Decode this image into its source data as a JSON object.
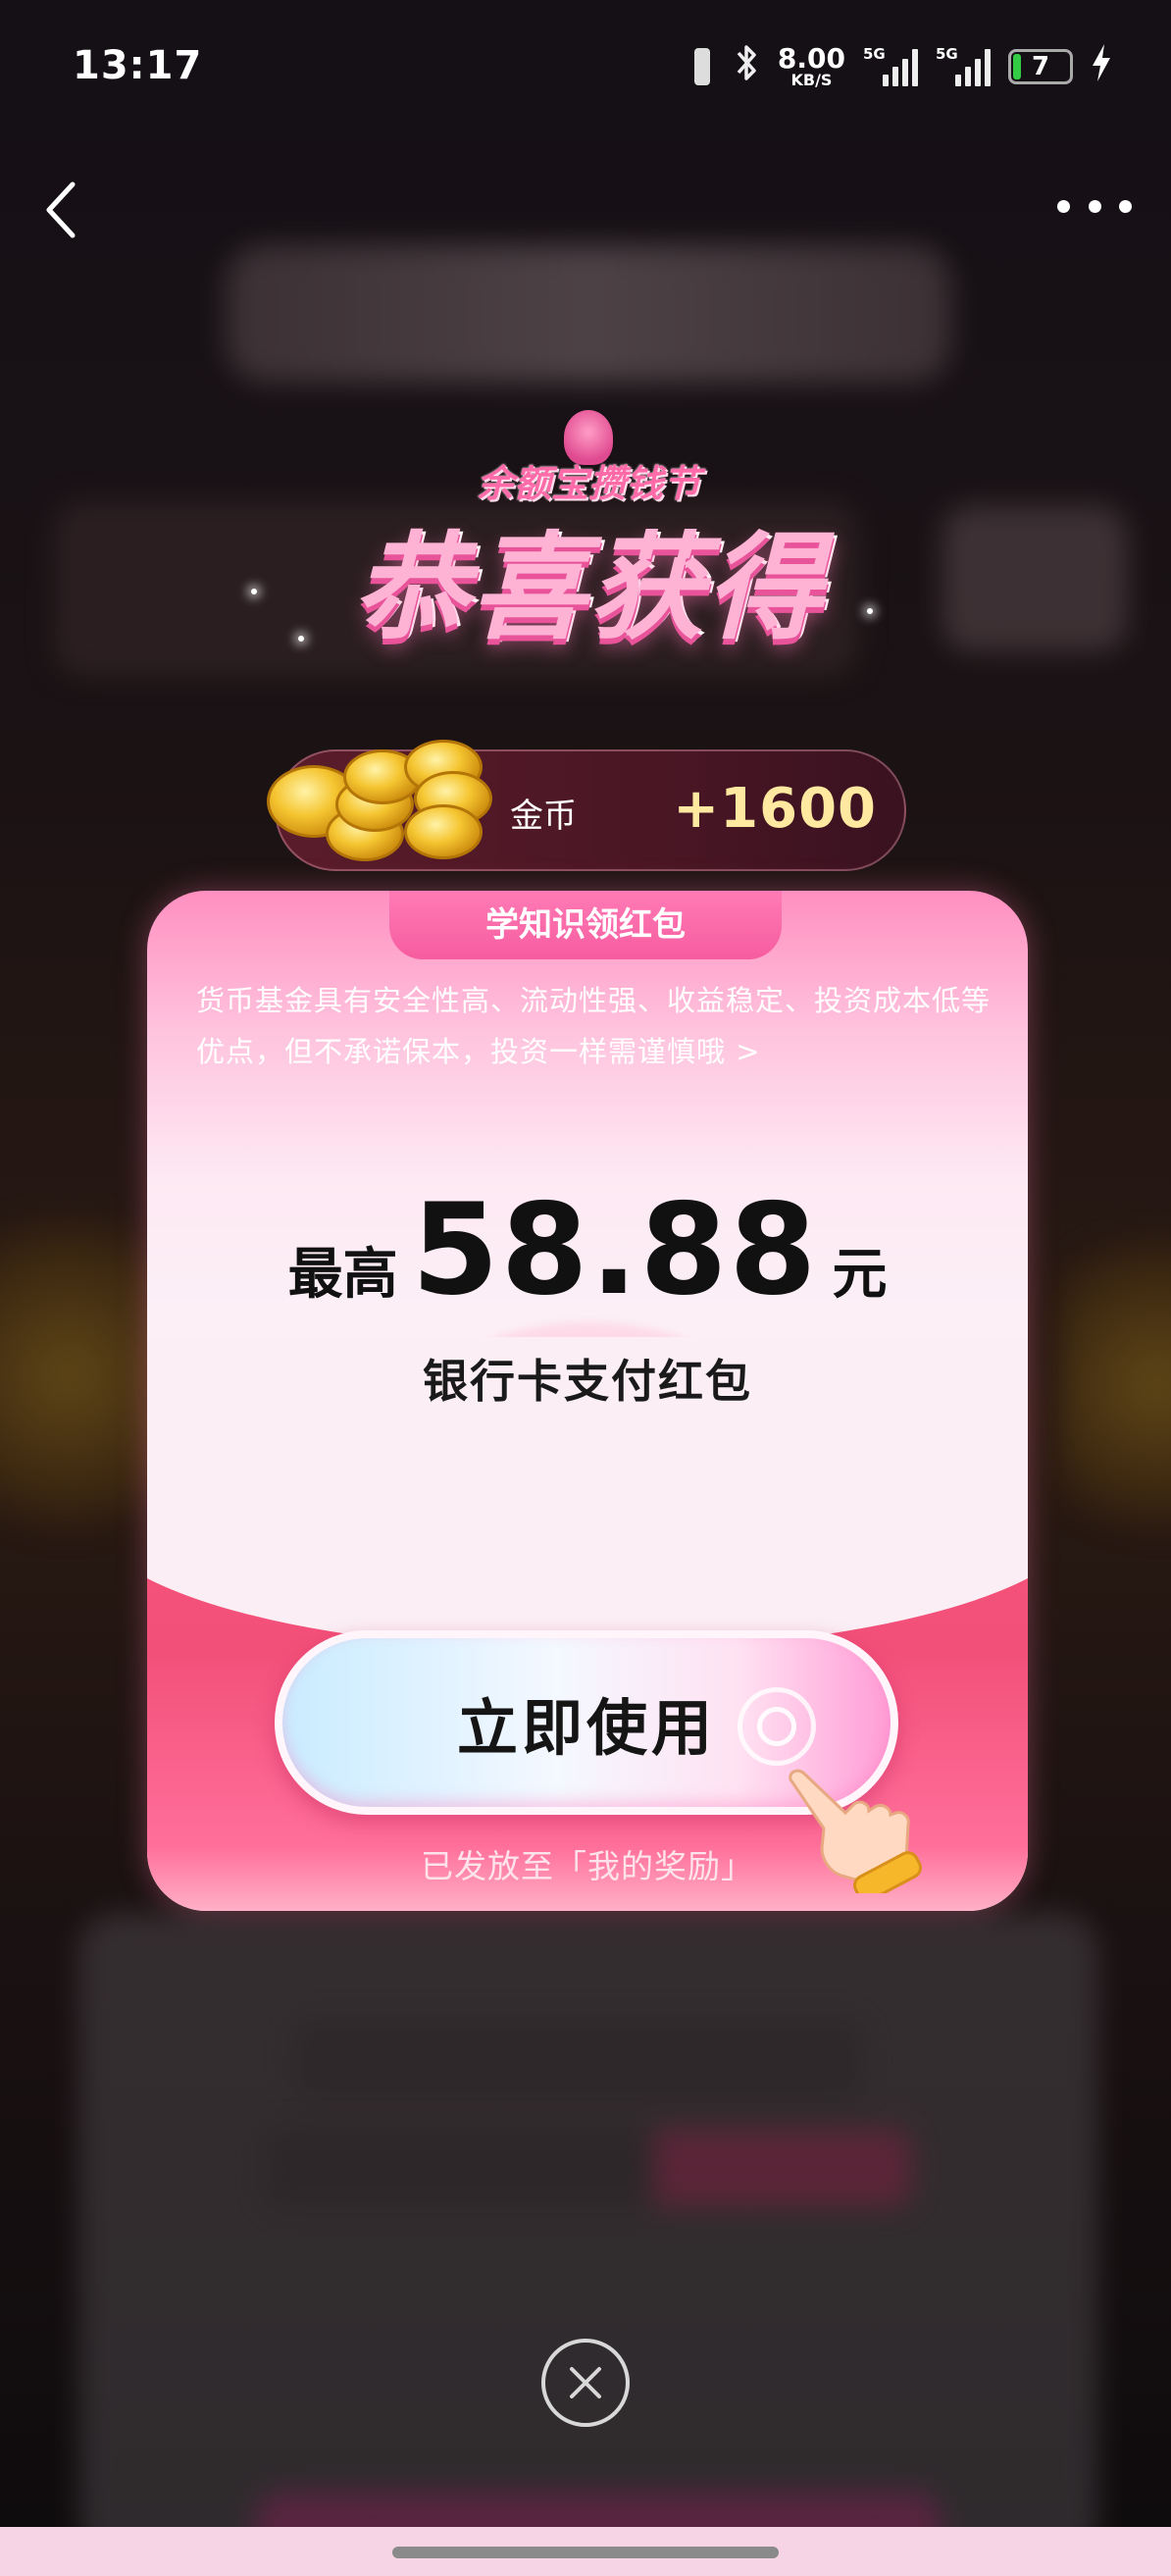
{
  "status_bar": {
    "time": "13:17",
    "net_speed": "8.00",
    "net_speed_unit": "KB/S",
    "signal1_label": "5G",
    "signal2_label": "5G",
    "battery_level": "7"
  },
  "nav": {
    "back_icon": "chevron-left-icon",
    "more_icon": "more-horizontal-icon"
  },
  "header": {
    "brand": "余额宝攒钱节",
    "congrats": "恭喜获得"
  },
  "reward": {
    "coin_label": "金币",
    "coin_amount": "+1600"
  },
  "card": {
    "tab_label": "学知识领红包",
    "description": "货币基金具有安全性高、流动性强、收益稳定、投资成本低等优点，但不承诺保本，投资一样需谨慎哦 >",
    "amount_prefix": "最高",
    "amount_value": "58.88",
    "amount_unit": "元",
    "subtitle": "银行卡支付红包",
    "button_label": "立即使用",
    "footer": "已发放至「我的奖励」"
  },
  "colors": {
    "accent_pink": "#f65c9f",
    "red_packet": "#f25079",
    "coin_amount": "#ffe9a0"
  }
}
